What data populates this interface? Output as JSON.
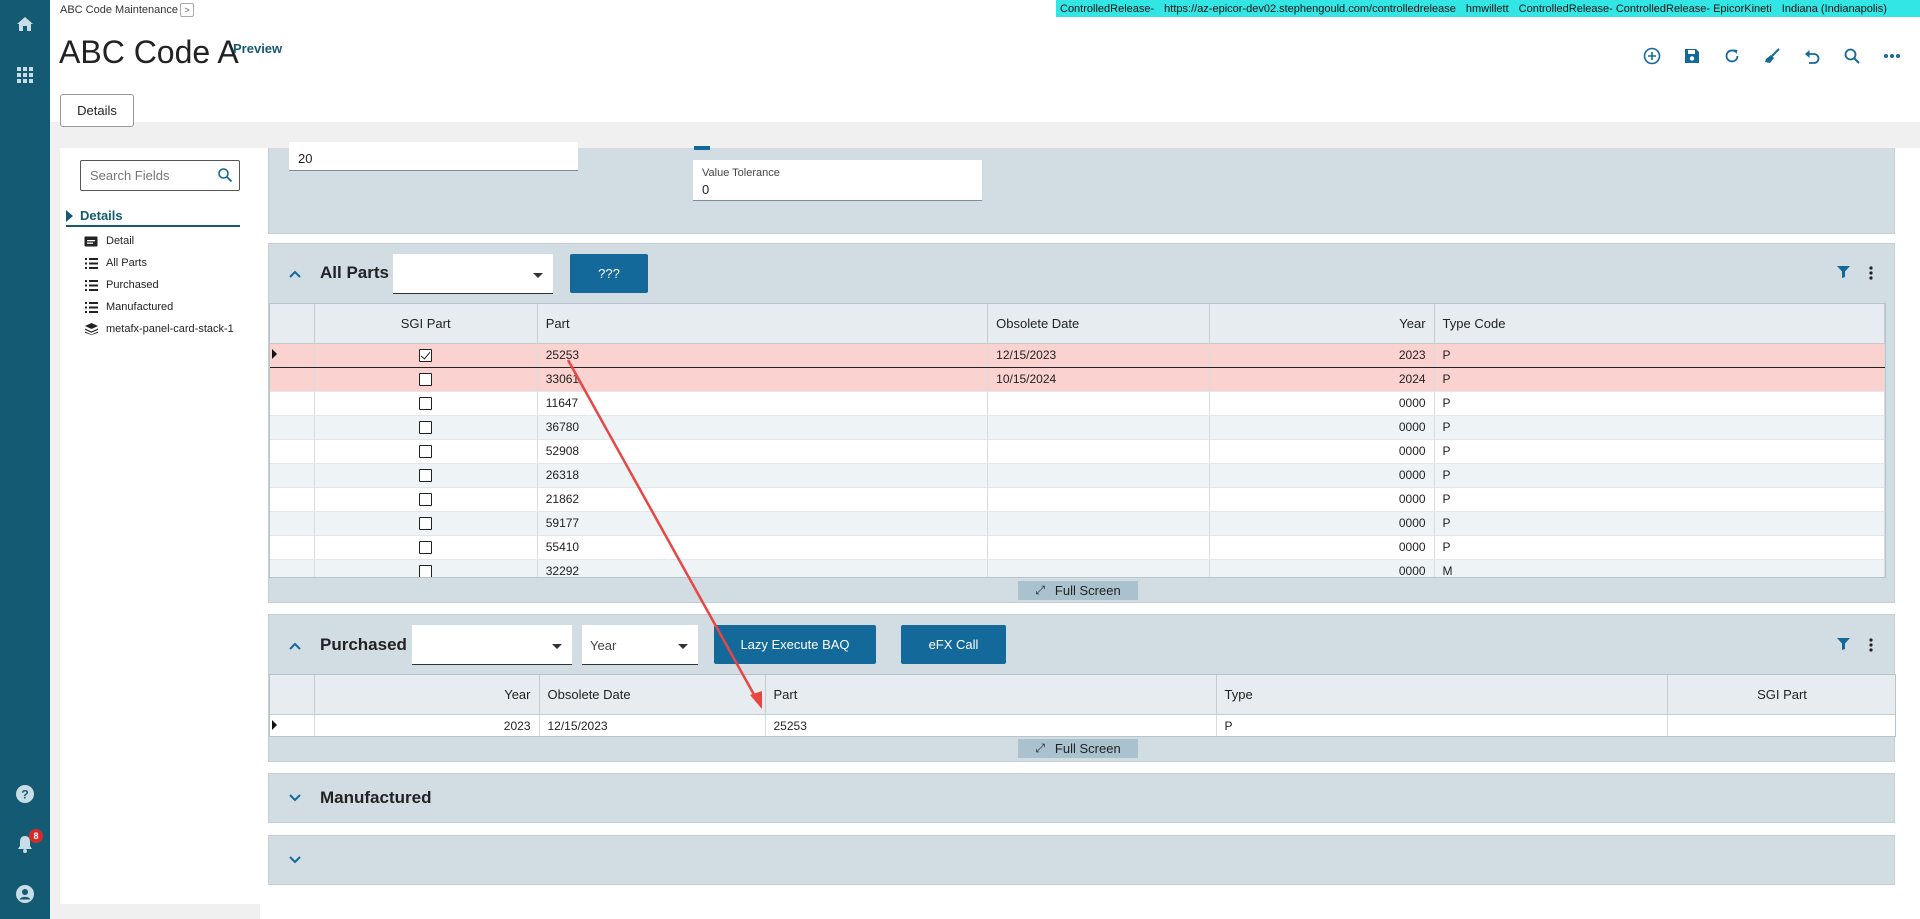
{
  "app": {
    "breadcrumb": "ABC Code Maintenance",
    "breadcrumb_more": ">",
    "title": "ABC Code A",
    "preview": "Preview",
    "details_button": "Details"
  },
  "env": {
    "items": [
      "ControlledRelease-",
      "https://az-epicor-dev02.stephengould.com/controlledrelease",
      "hmwillett",
      "ControlledRelease- ControlledRelease- EpicorKineti",
      "Indiana (Indianapolis)"
    ],
    "color": "#32e6e6"
  },
  "leftnav": {
    "icons": [
      "home-icon",
      "apps-grid-icon",
      "help-icon",
      "bell-icon",
      "user-icon"
    ],
    "notification_count": "8",
    "color": "#155a73"
  },
  "toolbar": {
    "icons": [
      "add-new-icon",
      "save-icon",
      "refresh-icon",
      "clear-icon",
      "undo-icon",
      "search-icon",
      "more-icon"
    ]
  },
  "sidebar": {
    "search_placeholder": "Search Fields",
    "section": "Details",
    "items": [
      {
        "label": "Detail",
        "icon": "card-icon"
      },
      {
        "label": "All Parts",
        "icon": "list-icon"
      },
      {
        "label": "Purchased",
        "icon": "list-icon"
      },
      {
        "label": "Manufactured",
        "icon": "list-icon"
      },
      {
        "label": "metafx-panel-card-stack-1",
        "icon": "stack-icon"
      }
    ]
  },
  "detail_panel": {
    "count_frequency_value": "20",
    "value_tolerance_label": "Value Tolerance",
    "value_tolerance_value": "0"
  },
  "all_parts": {
    "title": "All Parts",
    "dropdown_value": "",
    "button": "???",
    "columns": [
      "",
      "SGI Part",
      "Part",
      "Obsolete Date",
      "Year",
      "Type Code"
    ],
    "rows": [
      {
        "sgi": true,
        "part": "25253",
        "obsolete": "12/15/2023",
        "year": "2023",
        "type": "P"
      },
      {
        "sgi": false,
        "part": "33061",
        "obsolete": "10/15/2024",
        "year": "2024",
        "type": "P"
      },
      {
        "sgi": false,
        "part": "11647",
        "obsolete": "",
        "year": "0000",
        "type": "P"
      },
      {
        "sgi": false,
        "part": "36780",
        "obsolete": "",
        "year": "0000",
        "type": "P"
      },
      {
        "sgi": false,
        "part": "52908",
        "obsolete": "",
        "year": "0000",
        "type": "P"
      },
      {
        "sgi": false,
        "part": "26318",
        "obsolete": "",
        "year": "0000",
        "type": "P"
      },
      {
        "sgi": false,
        "part": "21862",
        "obsolete": "",
        "year": "0000",
        "type": "P"
      },
      {
        "sgi": false,
        "part": "59177",
        "obsolete": "",
        "year": "0000",
        "type": "P"
      },
      {
        "sgi": false,
        "part": "55410",
        "obsolete": "",
        "year": "0000",
        "type": "P"
      },
      {
        "sgi": false,
        "part": "32292",
        "obsolete": "",
        "year": "0000",
        "type": "M"
      }
    ],
    "fullscreen": "Full Screen"
  },
  "purchased": {
    "title": "Purchased",
    "dropdown1_value": "",
    "dropdown2_value": "Year",
    "button1": "Lazy Execute BAQ",
    "button2": "eFX Call",
    "columns": [
      "",
      "Year",
      "Obsolete Date",
      "Part",
      "Type",
      "SGI Part"
    ],
    "rows": [
      {
        "year": "2023",
        "obsolete": "12/15/2023",
        "part": "25253",
        "type": "P",
        "sgi": ""
      }
    ],
    "fullscreen": "Full Screen"
  },
  "manufactured": {
    "title": "Manufactured"
  },
  "colors": {
    "accent": "#136a9a",
    "panel_bg": "#d1dde2",
    "highlight_row": "#fad3d1",
    "annotation_arrow": "#e84545"
  }
}
